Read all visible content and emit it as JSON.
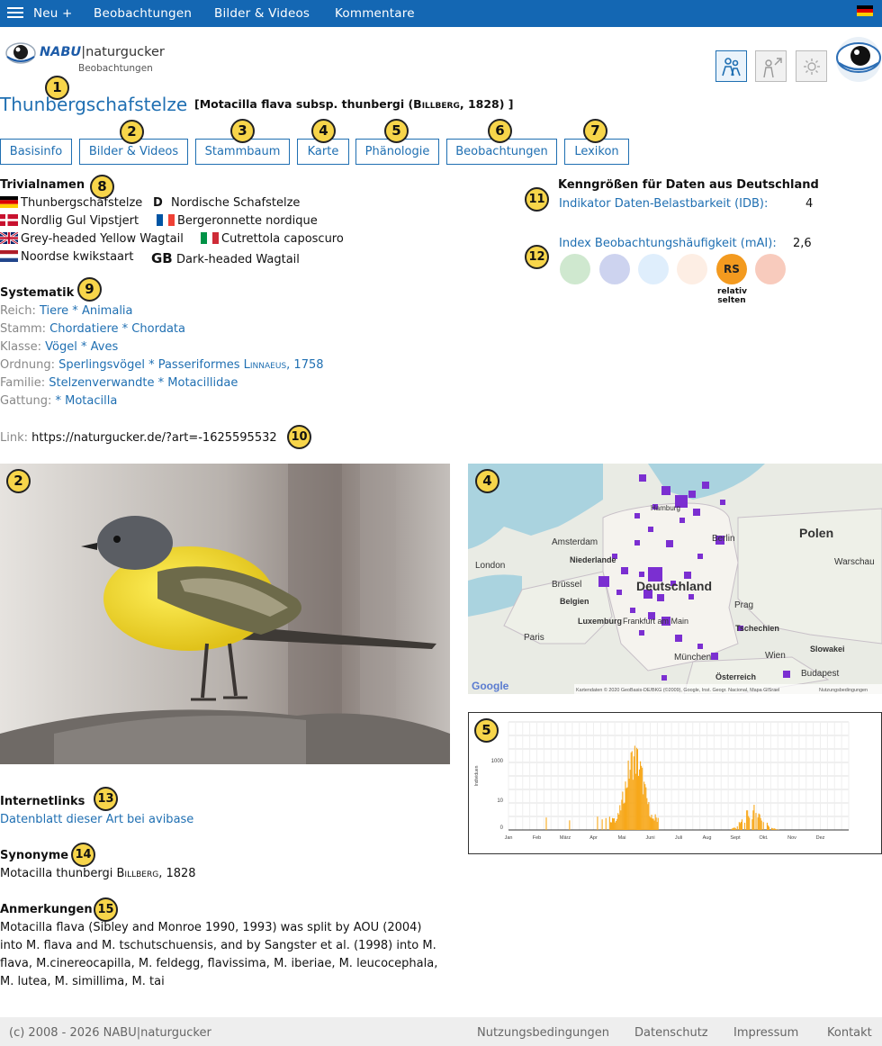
{
  "topnav": {
    "items": [
      "Neu +",
      "Beobachtungen",
      "Bilder & Videos",
      "Kommentare"
    ],
    "flag": "de-flag-icon"
  },
  "header": {
    "logo_brand": "NABU",
    "logo_sep": "|",
    "logo_name": "naturgucker",
    "logo_sub": "Beobachtungen",
    "icons": [
      "people-icon",
      "gender-icon",
      "settings-icon"
    ]
  },
  "species": {
    "title": "Thunbergschafstelze",
    "scientific_prefix": "[Motacilla flava subsp. thunbergi (",
    "scientific_author": "Billberg",
    "scientific_suffix": ", 1828) ]"
  },
  "tabs": [
    "Basisinfo",
    "Bilder & Videos",
    "Stammbaum",
    "Karte",
    "Phänologie",
    "Beobachtungen",
    "Lexikon"
  ],
  "trivialnamen": {
    "heading": "Trivialnamen",
    "names": [
      {
        "lang": "de",
        "name": "Thunbergschafstelze"
      },
      {
        "lang": "D",
        "name": "Nordische Schafstelze"
      },
      {
        "lang": "dk",
        "name": "Nordlig Gul Vipstjert"
      },
      {
        "lang": "fr",
        "name": "Bergeronnette nordique"
      },
      {
        "lang": "uk",
        "name": "Grey-headed Yellow Wagtail"
      },
      {
        "lang": "it",
        "name": "Cutrettola caposcuro"
      },
      {
        "lang": "nl",
        "name": "Noordse kwikstaart"
      },
      {
        "lang": "GB",
        "name": "Dark-headed Wagtail"
      }
    ]
  },
  "systematik": {
    "heading": "Systematik",
    "rows": [
      {
        "label": "Reich:",
        "value": "Tiere * Animalia"
      },
      {
        "label": "Stamm:",
        "value": "Chordatiere * Chordata"
      },
      {
        "label": "Klasse:",
        "value": "Vögel * Aves"
      },
      {
        "label": "Ordnung:",
        "value": "Sperlingsvögel * Passeriformes",
        "author": "Linnaeus",
        "year": ", 1758"
      },
      {
        "label": "Familie:",
        "value": "Stelzenverwandte * Motacillidae"
      },
      {
        "label": "Gattung:",
        "value": " * Motacilla"
      }
    ]
  },
  "link": {
    "label": "Link:",
    "url": "https://naturgucker.de/?art=-1625595532"
  },
  "kenngroessen": {
    "heading": "Kenngrößen für Daten aus Deutschland",
    "idb_label": "Indikator Daten-Belastbarkeit (IDB):",
    "idb_value": "4",
    "mai_label": "Index Beobachtungshäufigkeit (mAI):",
    "mai_value": "2,6",
    "circles": [
      {
        "color": "#cfe8cf",
        "label": ""
      },
      {
        "color": "#cdd3ef",
        "label": ""
      },
      {
        "color": "#dfeefc",
        "label": ""
      },
      {
        "color": "#fdeee4",
        "label": ""
      },
      {
        "color": "#f39a1f",
        "label": "RS"
      },
      {
        "color": "#f8cbbd",
        "label": ""
      }
    ],
    "active_caption_1": "relativ",
    "active_caption_2": "selten"
  },
  "map": {
    "labels": [
      "Polen",
      "Amsterdam",
      "Niederlande",
      "London",
      "Berlin",
      "Warschau",
      "Brüssel",
      "Belgien",
      "Deutschland",
      "Prag",
      "Luxemburg",
      "Frankfurt am Main",
      "Tschechien",
      "Paris",
      "München",
      "Wien",
      "Slowakei",
      "Budapest",
      "Österreich",
      "Hamburg"
    ],
    "google": "Google",
    "attribution": "Kartendaten © 2020 GeoBasis-DE/BKG (©2009), Google, Inst. Geogr. Nacional, Mapa GISrael",
    "terms": "Nutzungsbedingungen"
  },
  "chart_data": {
    "type": "bar",
    "ylabel": "Individuen",
    "yticks": [
      "1000",
      "10",
      "0"
    ],
    "xticks": [
      "Jan",
      "Feb",
      "März",
      "Apr",
      "Mai",
      "Juni",
      "Juli",
      "Aug",
      "Sept",
      "Okt.",
      "Nov",
      "Dez"
    ],
    "color": "#f7a81b"
  },
  "internetlinks": {
    "heading": "Internetlinks",
    "link": "Datenblatt dieser Art bei avibase"
  },
  "synonyme": {
    "heading": "Synonyme",
    "text_prefix": "Motacilla thunbergi ",
    "author": "Billberg",
    "text_suffix": ", 1828"
  },
  "anmerkungen": {
    "heading": "Anmerkungen",
    "lines": [
      "Motacilla flava (Sibley and Monroe 1990, 1993) was split by AOU (2004)",
      "into M. flava and M. tschutschuensis, and by Sangster et al. (1998) into M.",
      "flava, M.cinereocapilla, M. feldegg, flavissima, M. iberiae, M. leucocephala,",
      "M. lutea, M. simillima, M. tai"
    ]
  },
  "footer": {
    "copyright": "(c) 2008 - 2026 NABU|naturgucker",
    "links": [
      "Nutzungsbedingungen",
      "Datenschutz",
      "Impressum",
      "Kontakt"
    ]
  },
  "badges": [
    "1",
    "2",
    "3",
    "4",
    "5",
    "6",
    "7",
    "8",
    "9",
    "10",
    "11",
    "12",
    "13",
    "14",
    "15"
  ]
}
